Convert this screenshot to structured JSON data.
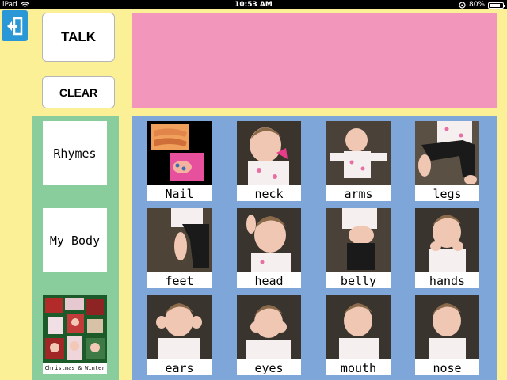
{
  "status_bar": {
    "device": "iPad",
    "time": "10:53 AM",
    "battery": "80%",
    "battery_level": 0.8
  },
  "toolbar": {
    "talk_label": "TALK",
    "clear_label": "CLEAR"
  },
  "message_bar": {
    "text": ""
  },
  "categories": [
    {
      "label": "Rhymes"
    },
    {
      "label": "My Body"
    },
    {
      "label": "Christmas & Winter"
    }
  ],
  "vocabulary": [
    {
      "label": "Nail"
    },
    {
      "label": "neck"
    },
    {
      "label": "arms"
    },
    {
      "label": "legs"
    },
    {
      "label": "feet"
    },
    {
      "label": "head"
    },
    {
      "label": "belly"
    },
    {
      "label": "hands"
    },
    {
      "label": "ears"
    },
    {
      "label": "eyes"
    },
    {
      "label": "mouth"
    },
    {
      "label": "nose"
    }
  ],
  "colors": {
    "background": "#fbf096",
    "message_bar": "#f297bb",
    "category_panel": "#8acd9c",
    "grid_panel": "#7ea6d8",
    "back_button": "#2a97d6"
  }
}
